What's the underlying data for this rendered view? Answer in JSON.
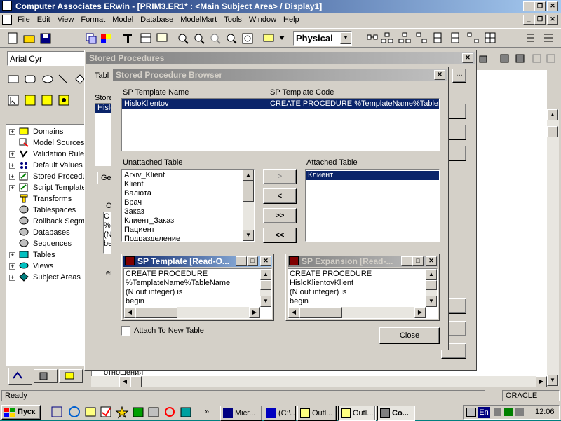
{
  "app": {
    "title": "Computer Associates ERwin - [PRIM3.ER1* : <Main Subject Area> / Display1]",
    "menu": [
      "File",
      "Edit",
      "View",
      "Format",
      "Model",
      "Database",
      "ModelMart",
      "Tools",
      "Window",
      "Help"
    ],
    "view_mode": "Physical",
    "font_name": "Arial Cyr",
    "status_left": "Ready",
    "status_db": "ORACLE"
  },
  "tree": {
    "items": [
      {
        "label": "Domains",
        "icon": "domain-icon"
      },
      {
        "label": "Model Sources",
        "icon": "model-source-icon"
      },
      {
        "label": "Validation Rules",
        "icon": "validation-icon"
      },
      {
        "label": "Default Values",
        "icon": "default-icon"
      },
      {
        "label": "Stored Procedures",
        "icon": "stored-proc-icon"
      },
      {
        "label": "Script Templates",
        "icon": "script-icon"
      },
      {
        "label": "Transforms",
        "icon": "transform-icon"
      },
      {
        "label": "Tablespaces",
        "icon": "tablespace-icon"
      },
      {
        "label": "Rollback Segments",
        "icon": "rollback-icon"
      },
      {
        "label": "Databases",
        "icon": "database-icon"
      },
      {
        "label": "Sequences",
        "icon": "sequence-icon"
      },
      {
        "label": "Tables",
        "icon": "table-icon"
      },
      {
        "label": "Views",
        "icon": "view-icon"
      },
      {
        "label": "Subject Areas",
        "icon": "subject-icon"
      }
    ]
  },
  "stored_procedures_dialog": {
    "title": "Stored Procedures",
    "table_label": "Tabl",
    "stored_label": "Store",
    "list_item": "Hislo",
    "tab_label": "Ge",
    "code_label": "C",
    "code_lines": [
      "C",
      "%",
      "(N",
      "be"
    ],
    "other_label": "er"
  },
  "browser": {
    "title": "Stored Procedure Browser",
    "col_template_name": "SP Template Name",
    "col_template_code": "SP Template Code",
    "row_name": "HisloKlientov",
    "row_code": "CREATE  PROCEDURE %TemplateName%TableNa",
    "unattached_label": "Unattached Table",
    "attached_label": "Attached Table",
    "unattached_items": [
      "Arxiv_Klient",
      "Klient",
      "Валюта",
      "Врач",
      "Заказ",
      "Клиент_Заказ",
      "Пациент",
      "Подразделение"
    ],
    "attached_items": [
      "Клиент"
    ],
    "btn_attach": ">",
    "btn_detach": "<",
    "btn_attach_all": ">>",
    "btn_detach_all": "<<",
    "template_title": "SP Template [Read-O...",
    "template_lines": [
      "CREATE  PROCEDURE",
      "%TemplateName%TableName",
      "(N out integer) is",
      "begin"
    ],
    "expansion_title": "SP Expansion [Read-...",
    "expansion_lines": [
      "CREATE  PROCEDURE",
      "HisloKlientovKlient",
      "(N out integer) is",
      "begin"
    ],
    "attach_checkbox": "Attach To New Table",
    "close_button": "Close"
  },
  "bottom_text": "отношения",
  "taskbar": {
    "start": "Пуск",
    "tasks": [
      "Micr...",
      "(C:\\...",
      "Outl...",
      "Outl...",
      "Co..."
    ],
    "lang": "En",
    "clock": "12:06"
  },
  "colors": {
    "desktop": "#008080",
    "face": "#d4d0c8",
    "highlight": "#0a246a"
  }
}
